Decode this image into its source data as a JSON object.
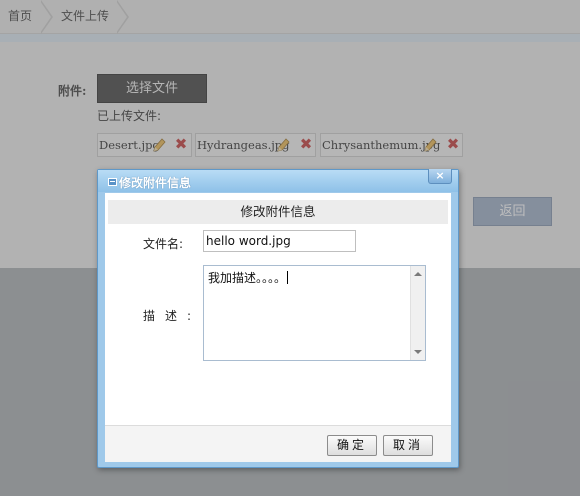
{
  "breadcrumb": {
    "items": [
      "首页",
      "文件上传"
    ]
  },
  "form": {
    "attachment_label": "附件:",
    "choose_file_button": "选择文件",
    "uploaded_files_label": "已上传文件:",
    "files": [
      {
        "name": "Desert.jpg"
      },
      {
        "name": "Hydrangeas.jpg"
      },
      {
        "name": "Chrysanthemum.jpg"
      }
    ],
    "back_button": "返回"
  },
  "modal": {
    "title": "修改附件信息",
    "close_symbol": "×",
    "heading": "修改附件信息",
    "filename_label": "文件名:",
    "filename_value": "hello word.jpg",
    "description_label": "描述:",
    "description_value": "我加描述。。。。",
    "ok_button": "确定",
    "cancel_button": "取消"
  },
  "colors": {
    "delete_icon": "#c03030",
    "edit_icon": "#d7a13a",
    "modal_border": "#5f98c8",
    "choose_button_bg": "#3a3a3a",
    "back_button_bg": "#97a9c4"
  }
}
